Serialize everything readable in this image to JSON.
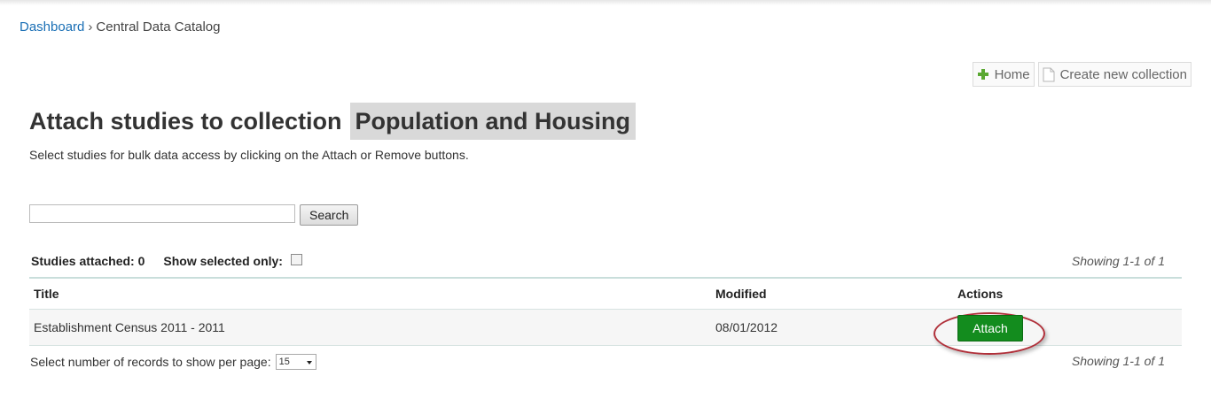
{
  "breadcrumb": {
    "home": "Dashboard",
    "separator": "›",
    "current": "Central Data Catalog"
  },
  "toolbar": {
    "home_label": "Home",
    "create_label": "Create new collection"
  },
  "page": {
    "title_prefix": "Attach studies to collection",
    "collection_name": "Population and Housing",
    "subtitle": "Select studies for bulk data access by clicking on the Attach or Remove buttons."
  },
  "search": {
    "value": "",
    "placeholder": "",
    "button_label": "Search"
  },
  "filters": {
    "attached_label": "Studies attached: 0",
    "show_selected_label": "Show selected only:",
    "show_selected_checked": false
  },
  "showing_text": "Showing 1-1 of 1",
  "table": {
    "headers": {
      "title": "Title",
      "modified": "Modified",
      "actions": "Actions"
    },
    "rows": [
      {
        "title": "Establishment Census 2011 - 2011",
        "modified": "08/01/2012",
        "action": "Attach"
      }
    ]
  },
  "pager": {
    "label": "Select number of records to show per page:",
    "per_page": "15"
  },
  "colors": {
    "link": "#1a6fb5",
    "attach_button": "#138c1e",
    "highlight_ring": "#b0303a"
  },
  "icons": {
    "home": "plus-icon",
    "create": "document-icon"
  }
}
